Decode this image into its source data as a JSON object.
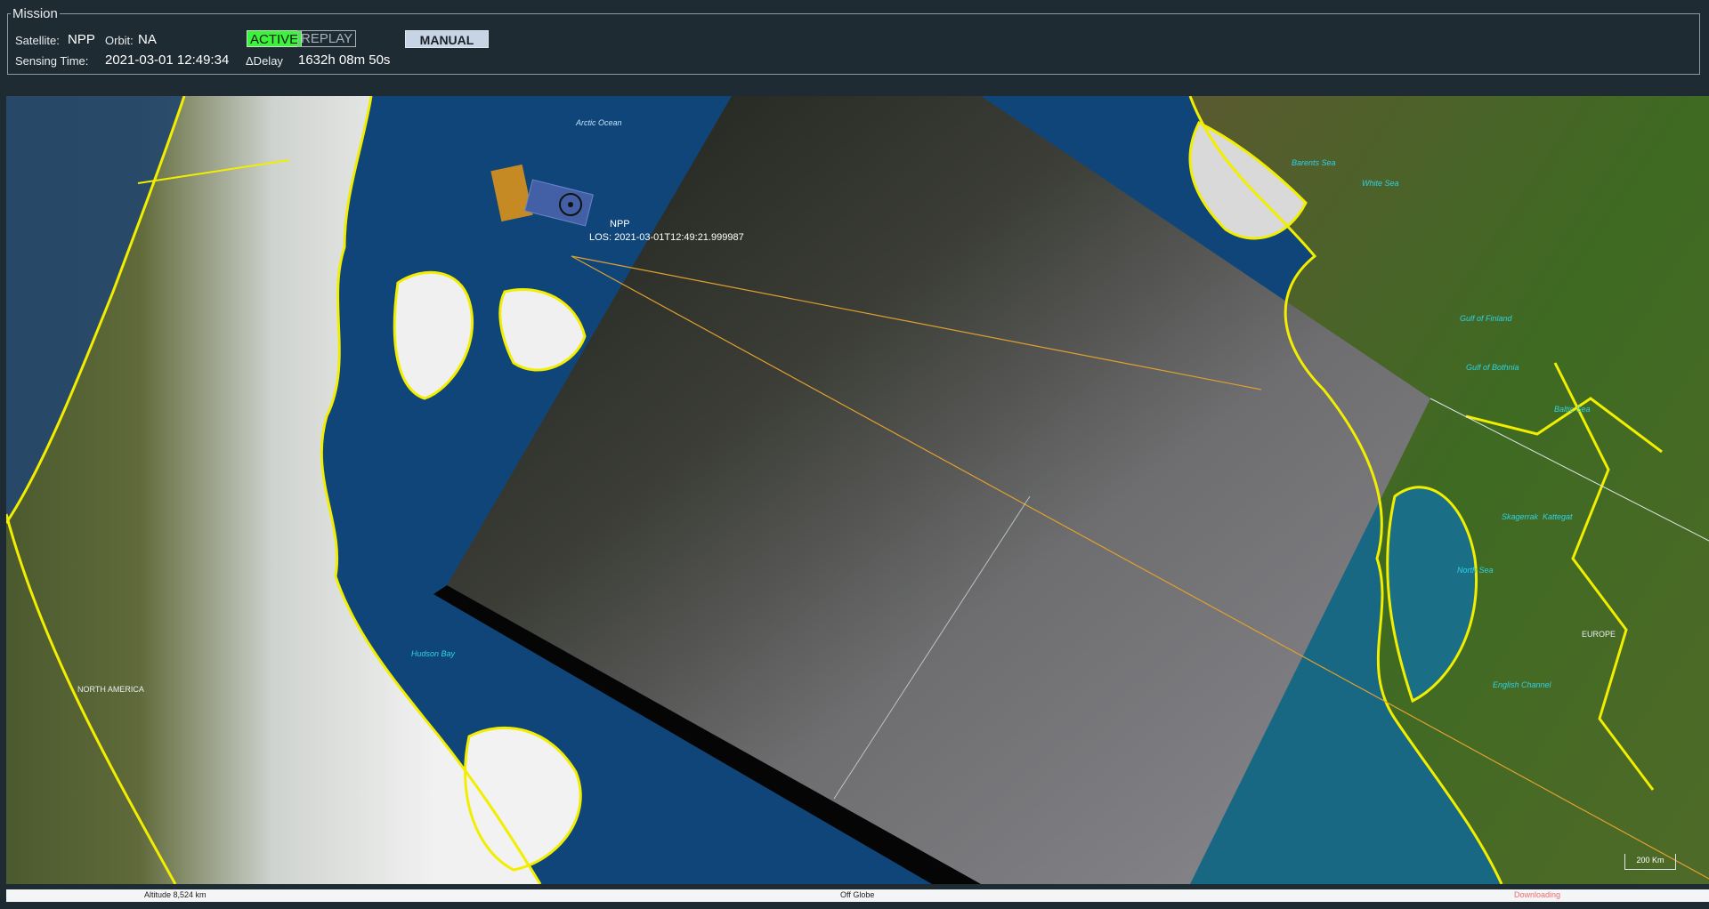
{
  "mission": {
    "legend": "Mission",
    "satellite_label": "Satellite:",
    "satellite_value": "NPP",
    "orbit_label": "Orbit:",
    "orbit_value": "NA",
    "sensing_time_label": "Sensing Time:",
    "sensing_time_value": "2021-03-01 12:49:34",
    "delay_label": "ΔDelay",
    "delay_value": "1632h 08m 50s",
    "active_button": "ACTIVE",
    "replay_button": "REPLAY",
    "manual_button": "MANUAL"
  },
  "map": {
    "satellite_name": "NPP",
    "los_text": "LOS: 2021-03-01T12:49:21.999987",
    "labels": {
      "arctic_ocean": "Arctic Ocean",
      "barents_sea": "Barents Sea",
      "white_sea": "White Sea",
      "gulf_of_finland": "Gulf of Finland",
      "gulf_of_bothnia": "Gulf of Bothnia",
      "baltic_sea": "Baltic Sea",
      "skagerrak": "Skagerrak",
      "kattegat": "Kattegat",
      "north_sea": "North Sea",
      "english_channel": "English Channel",
      "europe": "EUROPE",
      "north_america": "NORTH AMERICA",
      "hudson_bay": "Hudson Bay"
    },
    "scale": "200 Km"
  },
  "status_bar": {
    "altitude": "Altitude   8,524 km",
    "globe": "Off Globe",
    "state": "Downloading"
  },
  "colors": {
    "active": "#3df23d",
    "coastline": "#f2ee00",
    "footprint_line": "#e0a030",
    "downloading": "#f26b6b"
  }
}
